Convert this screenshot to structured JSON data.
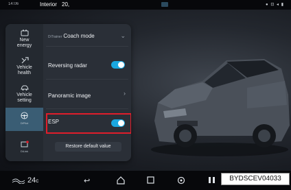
{
  "statusbar": {
    "time": "14:06",
    "title": "Interior",
    "value": "20,"
  },
  "sidebar": {
    "items": [
      {
        "label_line1": "New",
        "label_line2": "energy"
      },
      {
        "label_line1": "Vehicle",
        "label_line2": "health"
      },
      {
        "label_line1": "Vehicle",
        "label_line2": "setting"
      },
      {
        "label": "DiPilot"
      },
      {
        "label": "DiLink"
      }
    ]
  },
  "settings": {
    "coach_mode": {
      "prefix": "DiTrainer",
      "label": "Coach mode"
    },
    "reversing_radar": {
      "label": "Reversing radar",
      "state": "on"
    },
    "panoramic_image": {
      "label": "Panoramic image"
    },
    "esp": {
      "label": "ESP",
      "state": "on"
    },
    "restore_label": "Restore default value"
  },
  "bottombar": {
    "temperature": "24",
    "unit": "c"
  },
  "watermark_code": "BYDSCEV04033",
  "colors": {
    "accent": "#1aa7e0",
    "highlight": "#e11d2a",
    "panel": "#2a2f37"
  }
}
